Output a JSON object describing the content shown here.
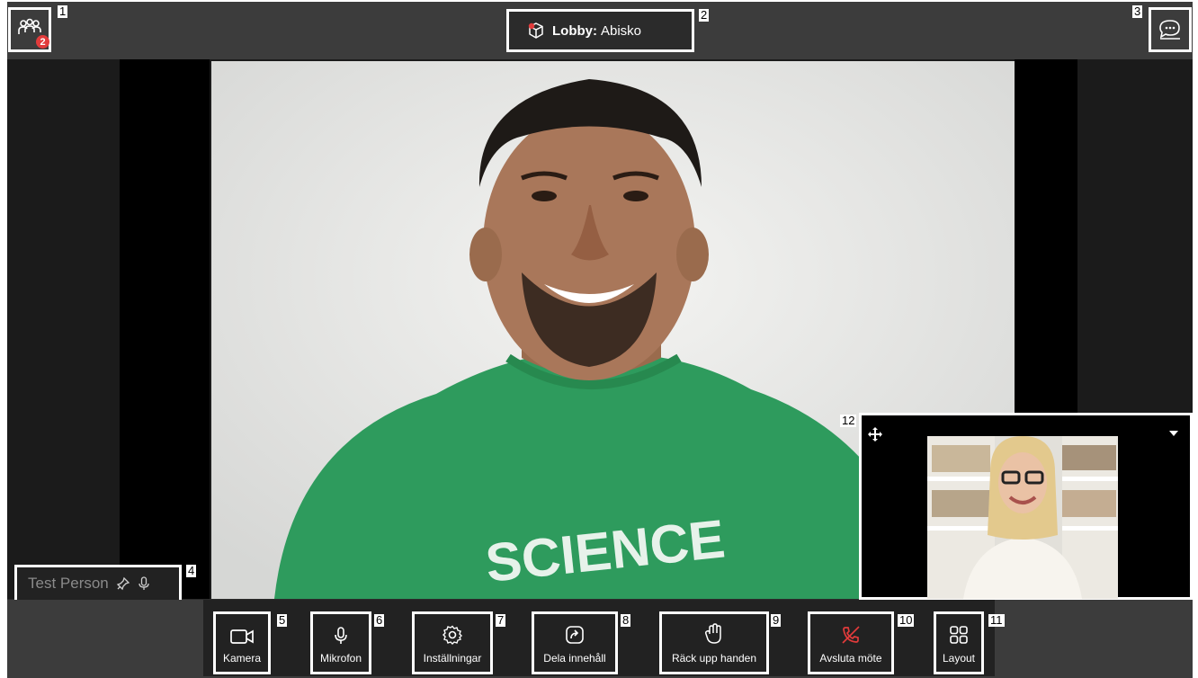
{
  "topbar": {
    "participant_count": "2",
    "lobby_label": "Lobby:",
    "lobby_name": "Abisko"
  },
  "annotations": [
    "1",
    "2",
    "3",
    "4",
    "5",
    "6",
    "7",
    "8",
    "9",
    "10",
    "11",
    "12"
  ],
  "main_video": {
    "participant_name": "Test Person",
    "shirt_text": "SCIENCE"
  },
  "toolbar": {
    "camera": "Kamera",
    "microphone": "Mikrofon",
    "settings": "Inställningar",
    "share": "Dela innehåll",
    "raise_hand": "Räck upp handen",
    "end_meeting": "Avsluta möte",
    "layout": "Layout"
  },
  "colors": {
    "topbar": "#3c3c3c",
    "badge": "#e23b3b",
    "end_icon": "#e23b3b",
    "highlight": "#ffffff"
  }
}
